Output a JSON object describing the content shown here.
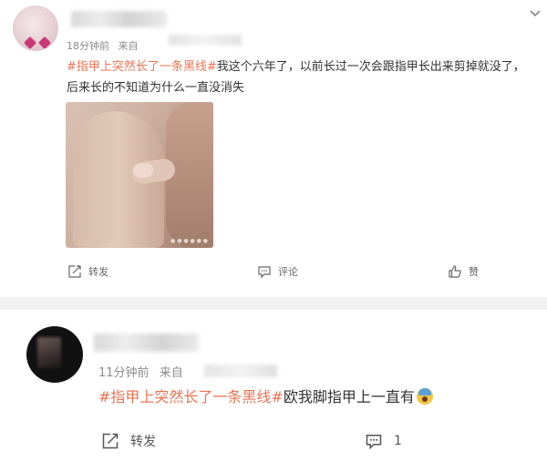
{
  "post1": {
    "time": "18分钟前",
    "source_prefix": "来自",
    "hashtag": "#指甲上突然长了一条黑线#",
    "text": "我这个六年了，以前长过一次会跟指甲长出来剪掉就没了，后来长的不知道为什么一直没消失",
    "actions": {
      "repost": "转发",
      "comment": "评论",
      "like": "赞"
    }
  },
  "post2": {
    "time": "11分钟前",
    "source_prefix": "来自",
    "hashtag": "#指甲上突然长了一条黑线#",
    "text": "欧我脚指甲上一直有",
    "emoji": "scream-face-emoji",
    "actions": {
      "repost": "转发",
      "comment_count": "1"
    }
  },
  "icons": {
    "more": "chevron-down-icon",
    "repost": "repost-icon",
    "comment": "comment-icon",
    "like": "thumbs-up-icon"
  },
  "colors": {
    "hashtag": "#eb7350",
    "meta": "#8b8b8b",
    "separator": "#f2f2f2"
  }
}
